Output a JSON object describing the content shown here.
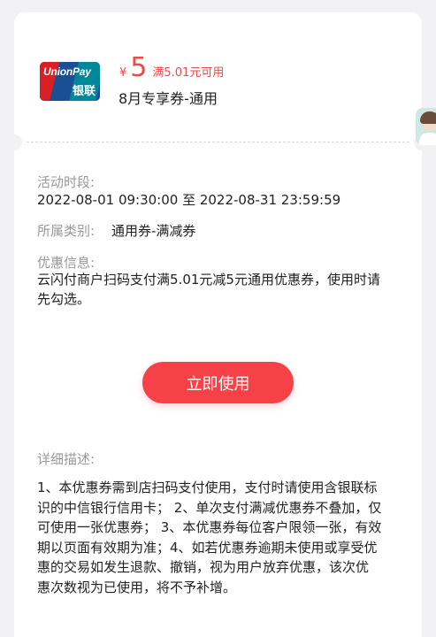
{
  "coupon": {
    "brand_logo": {
      "icon": "unionpay-logo",
      "text_en": "UnionPay",
      "text_cn": "银联",
      "colors": {
        "red": "#d91f26",
        "blue": "#1b4f93",
        "teal": "#00889a"
      }
    },
    "currency": "¥",
    "amount": "5",
    "condition": "满5.01元可用",
    "name": "8月专享券-通用"
  },
  "details": {
    "period_label": "活动时段:",
    "period_value": "2022-08-01 09:30:00 至 2022-08-31 23:59:59",
    "category_label": "所属类别:",
    "category_value": "通用券-满减券",
    "offer_label": "优惠信息:",
    "offer_line1": "云闪付商户扫码支付满5.01元减5元通用优惠券，使用时请",
    "offer_line2": "先勾选。"
  },
  "actions": {
    "use_button": "立即使用"
  },
  "description": {
    "label": "详细描述:",
    "lines": [
      "1、本优惠券需到店扫码支付使用，支付时请使用含银联标",
      "识的中信银行信用卡； 2、单次支付满减优惠券不叠加，仅",
      "可使用一张优惠券； 3、本优惠券每位客户限领一张，有效",
      "期以页面有效期为准；4、如若优惠券逾期未使用或享受优",
      "惠的交易如发生退款、撤销，视为用户放弃优惠，该次优",
      "惠次数视为已使用，将不予补增。"
    ]
  },
  "side": {
    "avatar_icon": "assistant-avatar"
  },
  "colors": {
    "accent": "#f64247",
    "price": "#f04848",
    "background": "#f2f2f4"
  }
}
